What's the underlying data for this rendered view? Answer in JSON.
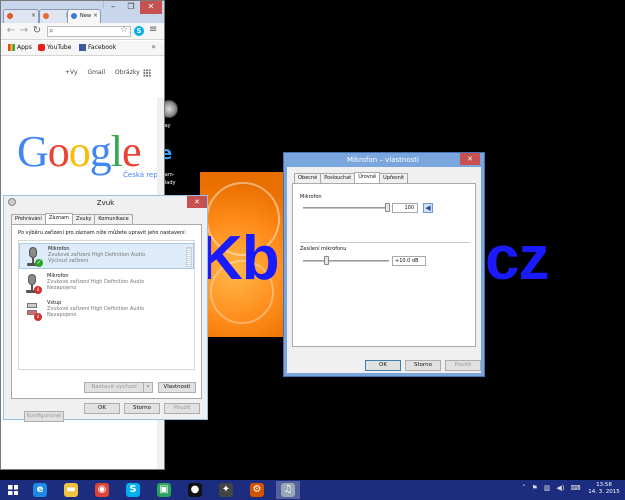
{
  "chrome": {
    "tabs": [
      {
        "label": "",
        "favicon_color": "#e3572b"
      },
      {
        "label": "",
        "favicon_color": "#e56b2c"
      },
      {
        "label": "New",
        "favicon_color": "#3c78d8"
      }
    ],
    "bookmarks": [
      {
        "label": "Apps",
        "icon": "apps-grid-icon"
      },
      {
        "label": "YouTube",
        "icon": "youtube-icon"
      },
      {
        "label": "Facebook",
        "icon": "facebook-icon"
      }
    ],
    "google_links": {
      "plus": "+Vy",
      "gmail": "Gmail",
      "images": "Obrázky"
    },
    "logo_text": "Google",
    "logo_colors": [
      "#4285f4",
      "#ea4335",
      "#fbbc05",
      "#4285f4",
      "#34a853",
      "#ea4335"
    ],
    "country": "Česká rep"
  },
  "desktop": {
    "icon1_label": "play",
    "icon2_label_1": "cam-",
    "icon2_label_2": "klady",
    "wallpaper_left": "Kb",
    "wallpaper_right": "cz"
  },
  "zvuk": {
    "title": "Zvuk",
    "tabs": [
      "Přehrávání",
      "Záznam",
      "Zvuky",
      "Komunikace"
    ],
    "active_tab": 1,
    "instruction": "Po výběru zařízení pro záznam níže můžete upravit jeho nastavení:",
    "devices": [
      {
        "name": "Mikrofon",
        "line2": "Zvukové zařízení High Definition Audio",
        "line3": "Výchozí zařízení",
        "status": "ok"
      },
      {
        "name": "Mikrofon",
        "line2": "Zvukové zařízení High Definition Audio",
        "line3": "Nezapojeno",
        "status": "down"
      },
      {
        "name": "Vstup",
        "line2": "Zvukové zařízení High Definition Audio",
        "line3": "Nezapojeno",
        "status": "down"
      }
    ],
    "buttons": {
      "configure": "Konfigurovat",
      "set_default": "Nastavit výchozí",
      "properties": "Vlastnosti",
      "ok": "OK",
      "cancel": "Storno",
      "apply": "Použít"
    }
  },
  "props": {
    "title": "Mikrofon – vlastnosti",
    "tabs": [
      "Obecné",
      "Poslouchat",
      "Úrovně",
      "Upřesnit"
    ],
    "active_tab": 2,
    "mic_label": "Mikrofon",
    "mic_value": "100",
    "mic_level": 1.0,
    "boost_label": "Zesílení mikrofonu",
    "boost_value": "+10.0 dB",
    "boost_level": 0.25,
    "buttons": {
      "ok": "OK",
      "cancel": "Storno",
      "apply": "Použít"
    }
  },
  "taskbar": {
    "apps": [
      {
        "name": "ie",
        "color": "#1e88e5",
        "glyph": "e"
      },
      {
        "name": "explorer",
        "color": "#f0c040",
        "glyph": "▬"
      },
      {
        "name": "chrome",
        "color": "#db4437",
        "glyph": "◉"
      },
      {
        "name": "skype",
        "color": "#00aff0",
        "glyph": "S"
      },
      {
        "name": "store",
        "color": "#2aa35b",
        "glyph": "▣"
      },
      {
        "name": "record",
        "color": "#111111",
        "glyph": "●"
      },
      {
        "name": "counter-strike",
        "color": "#444444",
        "glyph": "✦"
      },
      {
        "name": "game",
        "color": "#d35400",
        "glyph": "⚙"
      },
      {
        "name": "sound",
        "color": "#9aa7b8",
        "glyph": "♫"
      }
    ],
    "time": "13:58",
    "date": "14. 3. 2015"
  }
}
